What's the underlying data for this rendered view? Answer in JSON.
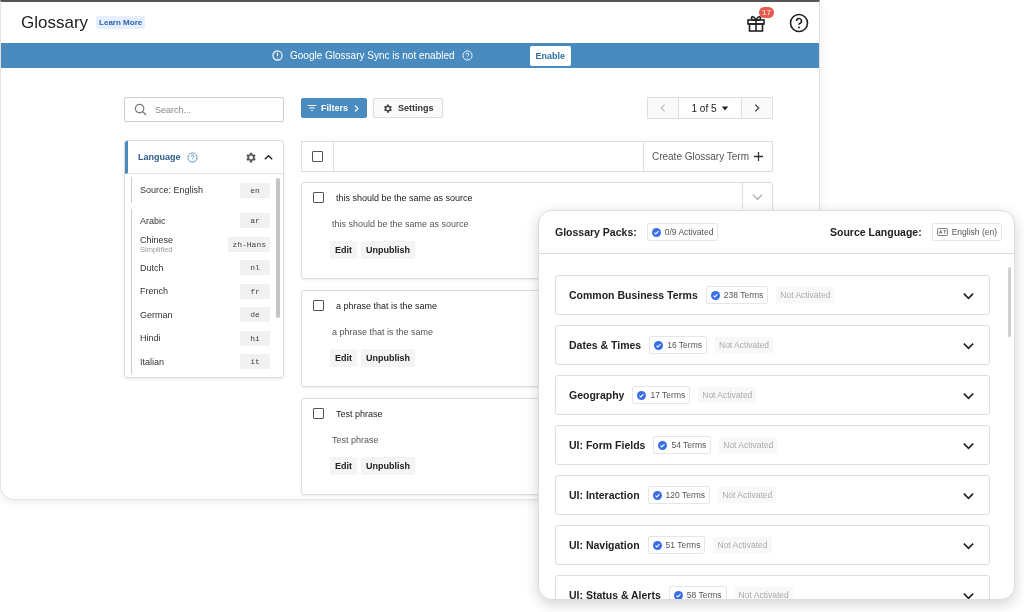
{
  "header": {
    "title": "Glossary",
    "learn_more": "Learn More",
    "gift_badge": "17"
  },
  "banner": {
    "message": "Google Glossary Sync is not enabled",
    "button": "Enable"
  },
  "search": {
    "placeholder": "Search..."
  },
  "toolbar": {
    "filters": "Filters",
    "settings": "Settings",
    "pager": "1 of 5"
  },
  "language_panel": {
    "title": "Language",
    "expanded": true,
    "source": {
      "name": "Source: English",
      "code": "en"
    },
    "languages": [
      {
        "name": "Arabic",
        "code": "ar"
      },
      {
        "name": "Chinese",
        "sub": "Simplified",
        "code": "zh-Hans"
      },
      {
        "name": "Dutch",
        "code": "nl"
      },
      {
        "name": "French",
        "code": "fr"
      },
      {
        "name": "German",
        "code": "de"
      },
      {
        "name": "Hindi",
        "code": "hi"
      },
      {
        "name": "Italian",
        "code": "it"
      }
    ]
  },
  "terms": {
    "all_checked": false,
    "create": "Create Glossary Term",
    "items": [
      {
        "term": "this should be the same as source",
        "translation": "this should be the same as source",
        "checked": false,
        "actions": [
          "Edit",
          "Unpublish"
        ]
      },
      {
        "term": "a phrase that is the same",
        "translation": "a phrase that is the same",
        "checked": false,
        "actions": [
          "Edit",
          "Unpublish"
        ]
      },
      {
        "term": "Test phrase",
        "translation": "Test phrase",
        "checked": false,
        "actions": [
          "Edit",
          "Unpublish"
        ]
      }
    ]
  },
  "packs_panel": {
    "title": "Glossary Packs:",
    "activated": "0/9 Activated",
    "source_label": "Source Language:",
    "source_value": "English (en)",
    "packs": [
      {
        "name": "Common Business Terms",
        "terms": "238 Terms",
        "status": "Not Activated"
      },
      {
        "name": "Dates & Times",
        "terms": "16 Terms",
        "status": "Not Activated"
      },
      {
        "name": "Geography",
        "terms": "17 Terms",
        "status": "Not Activated"
      },
      {
        "name": "UI: Form Fields",
        "terms": "54 Terms",
        "status": "Not Activated"
      },
      {
        "name": "UI: Interaction",
        "terms": "120 Terms",
        "status": "Not Activated"
      },
      {
        "name": "UI: Navigation",
        "terms": "51 Terms",
        "status": "Not Activated"
      },
      {
        "name": "UI: Status & Alerts",
        "terms": "58 Terms",
        "status": "Not Activated"
      }
    ]
  }
}
